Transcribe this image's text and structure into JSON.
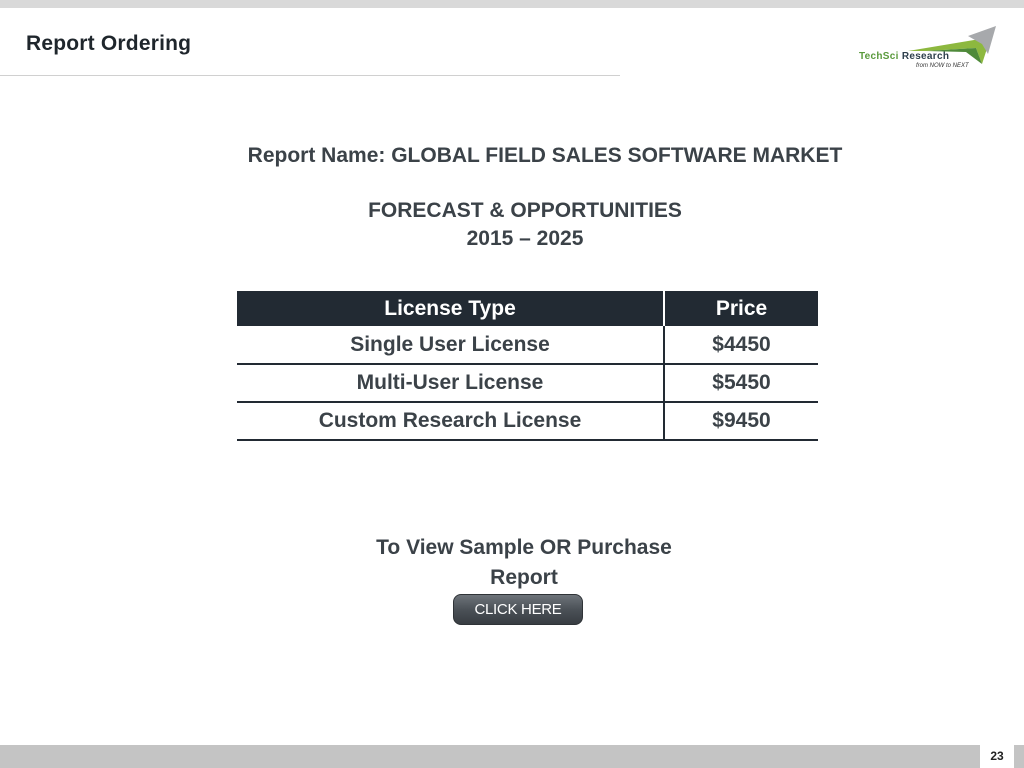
{
  "header": {
    "title": "Report Ordering",
    "logo": {
      "brand_part1": "TechSci",
      "brand_part2": "Research",
      "tagline": "from NOW to NEXT",
      "accent_green": "#5a9a3c",
      "accent_dark": "#2e3f4c"
    }
  },
  "report": {
    "name_line": "Report Name: GLOBAL FIELD SALES SOFTWARE MARKET",
    "forecast_line": "FORECAST & OPPORTUNITIES",
    "years_line": "2015 – 2025"
  },
  "license_table": {
    "headers": {
      "type": "License Type",
      "price": "Price"
    },
    "rows": [
      {
        "type": "Single User License",
        "price": "$4450"
      },
      {
        "type": "Multi-User License",
        "price": "$5450"
      },
      {
        "type": "Custom Research License",
        "price": "$9450"
      }
    ]
  },
  "cta": {
    "line1": "To View Sample OR Purchase",
    "line2": "Report",
    "button_label": "CLICK HERE"
  },
  "footer": {
    "page_number": "23"
  },
  "colors": {
    "table_header_bg": "#222a33",
    "heading_text": "#3b4248"
  }
}
